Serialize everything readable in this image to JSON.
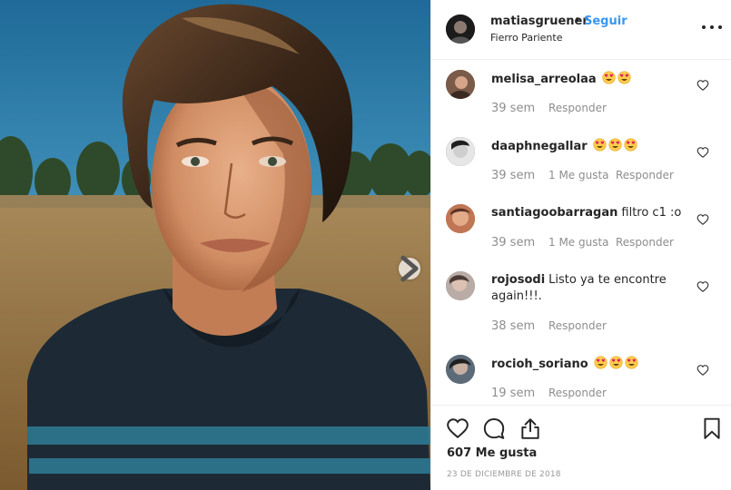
{
  "post": {
    "author": "matiasgruener",
    "follow_label": "Seguir",
    "separator": "•",
    "location": "Fierro Pariente",
    "more_icon": "more-horizontal-icon",
    "next_icon": "chevron-right-icon"
  },
  "comments": [
    {
      "username": "melisa_arreolaa",
      "text": "",
      "emojis": 2,
      "time": "39 sem",
      "likes": "",
      "reply_label": "Responder",
      "avatar_color": "#7a5a48"
    },
    {
      "username": "daaphnegallar",
      "text": "",
      "emojis": 3,
      "time": "39 sem",
      "likes": "1 Me gusta",
      "reply_label": "Responder",
      "avatar_color": "#3b3b3b"
    },
    {
      "username": "santiagoobarragan",
      "text": "filtro c1 :o",
      "emojis": 0,
      "time": "39 sem",
      "likes": "1 Me gusta",
      "reply_label": "Responder",
      "avatar_color": "#b46a4a"
    },
    {
      "username": "rojosodi",
      "text": "Listo ya te encontre again!!!.",
      "emojis": 0,
      "time": "38 sem",
      "likes": "",
      "reply_label": "Responder",
      "avatar_color": "#9a8c86"
    },
    {
      "username": "rocioh_soriano",
      "text": "",
      "emojis": 3,
      "time": "19 sem",
      "likes": "",
      "reply_label": "Responder",
      "avatar_color": "#4a5866"
    }
  ],
  "actions": {
    "like_icon": "heart-icon",
    "comment_icon": "comment-icon",
    "share_icon": "share-icon",
    "save_icon": "bookmark-icon"
  },
  "likes_text": "607 Me gusta",
  "date_text": "23 DE DICIEMBRE DE 2018",
  "colors": {
    "accent": "#3897f0",
    "text": "#262626",
    "muted": "#8e8e8e",
    "border": "#efefef"
  }
}
